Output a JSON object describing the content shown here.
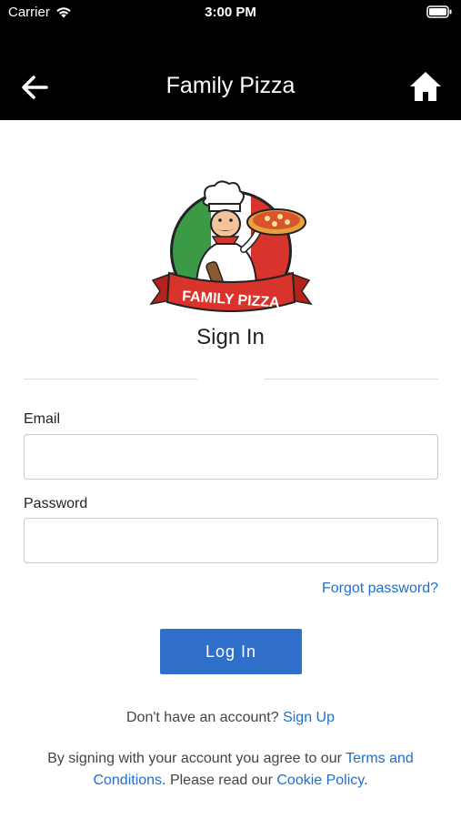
{
  "status_bar": {
    "carrier": "Carrier",
    "time": "3:00 PM"
  },
  "nav": {
    "title": "Family Pizza"
  },
  "logo": {
    "banner_text": "FAMILY PIZZA"
  },
  "page": {
    "title": "Sign In"
  },
  "form": {
    "email_label": "Email",
    "email_value": "",
    "password_label": "Password",
    "password_value": "",
    "forgot_label": "Forgot password?",
    "login_label": "Log In"
  },
  "footer": {
    "no_account": "Don't have an account?",
    "sign_up": "Sign Up",
    "terms_prefix": "By signing with your account you agree to our",
    "terms_link": "Terms and Conditions",
    "terms_middle": ". Please read our",
    "cookie_link": "Cookie Policy",
    "terms_end": "."
  },
  "colors": {
    "nav_bg": "#000000",
    "accent": "#2f6fc9",
    "link": "#1e6fd0"
  }
}
